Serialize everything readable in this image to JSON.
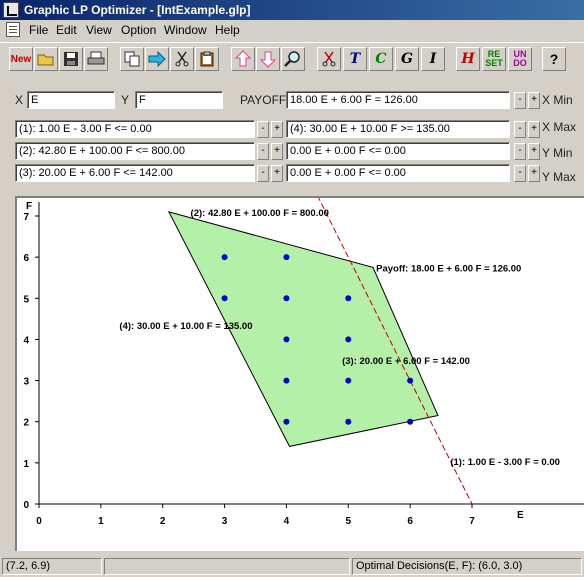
{
  "window": {
    "title": "Graphic LP Optimizer - [IntExample.glp]"
  },
  "menu": [
    "File",
    "Edit",
    "View",
    "Option",
    "Window",
    "Help"
  ],
  "toolbar": {
    "new_label": "New",
    "text_tool_label": "T",
    "c_tool_label": "C",
    "g_tool_label": "G",
    "i_tool_label": "I",
    "h_tool_label": "H",
    "reset_label": "RE SET",
    "undo_label": "UN DO",
    "help_label": "?"
  },
  "variables": {
    "x_label": "X",
    "x_value": "E",
    "y_label": "Y",
    "y_value": "F"
  },
  "payoff": {
    "label": "PAYOFF",
    "value": "18.00 E + 6.00 F = 126.00"
  },
  "constraints": [
    "(1): 1.00 E - 3.00 F <= 0.00",
    "(2): 42.80 E + 100.00 F <= 800.00",
    "(3): 20.00 E + 6.00 F <= 142.00",
    "(4): 30.00 E + 10.00 F >= 135.00",
    "0.00 E + 0.00 F <= 0.00",
    "0.00 E + 0.00 F <= 0.00"
  ],
  "spin": {
    "minus": "-",
    "plus": "+"
  },
  "range_labels": [
    "X Min",
    "X Max",
    "Y Min",
    "Y Max"
  ],
  "chart_data": {
    "type": "scatter",
    "xlabel": "E",
    "ylabel": "F",
    "xlim": [
      0,
      7
    ],
    "ylim": [
      0,
      7
    ],
    "x_ticks": [
      "0",
      "1",
      "2",
      "3",
      "4",
      "5",
      "6",
      "7"
    ],
    "y_ticks": [
      "0",
      "1",
      "2",
      "3",
      "4",
      "5",
      "6",
      "7"
    ],
    "feasible_region": [
      [
        2.1,
        7.1
      ],
      [
        5.4,
        5.75
      ],
      [
        6.45,
        2.15
      ],
      [
        4.05,
        1.4
      ]
    ],
    "feasible_color": "#b4f0a8",
    "integer_points": [
      [
        3,
        6
      ],
      [
        4,
        6
      ],
      [
        3,
        5
      ],
      [
        4,
        5
      ],
      [
        5,
        5
      ],
      [
        4,
        4
      ],
      [
        5,
        4
      ],
      [
        4,
        3
      ],
      [
        5,
        3
      ],
      [
        6,
        3
      ],
      [
        4,
        2
      ],
      [
        5,
        2
      ],
      [
        6,
        2
      ]
    ],
    "point_color": "#0000c0",
    "payoff_line": {
      "from": [
        4.5,
        7.5
      ],
      "to": [
        7.0,
        0.0
      ],
      "color": "#c00000",
      "style": "dashed"
    },
    "annotations": [
      {
        "text": "(2): 42.80 E + 100.00 F = 800.00",
        "x": 2.45,
        "y": 7.1
      },
      {
        "text": "Payoff: 18.00 E +  6.00 F = 126.00",
        "x": 5.45,
        "y": 5.75
      },
      {
        "text": "(4): 30.00 E + 10.00 F = 135.00",
        "x": 1.3,
        "y": 4.35
      },
      {
        "text": "(3): 20.00 E +  6.00 F = 142.00",
        "x": 4.9,
        "y": 3.5
      },
      {
        "text": "(1):  1.00 E -  3.00 F =  0.00",
        "x": 6.65,
        "y": 1.05
      }
    ]
  },
  "status": {
    "cursor": "(7.2,  6.9)",
    "optimal": "Optimal Decisions(E, F):  (6.0,  3.0)"
  }
}
